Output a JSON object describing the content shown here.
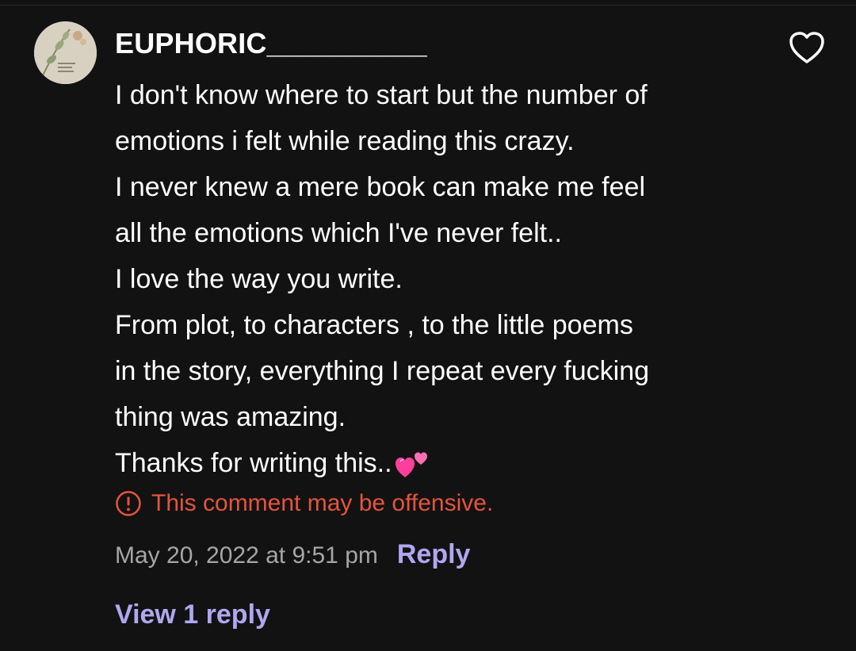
{
  "comment": {
    "username": "EUPHORIC__________",
    "lines": [
      "I don't know where to start but the number of",
      "emotions i felt while reading this crazy.",
      "I never knew a mere book can make me feel",
      "all the emotions which I've never felt..",
      "I love the way you write.",
      "From plot, to characters , to the little poems",
      "in the story,  everything I repeat every fucking",
      "thing was amazing.",
      "Thanks for writing this.."
    ],
    "trailing_emoji": "two-hearts-icon",
    "warning_text": "This comment may be offensive.",
    "timestamp": "May 20, 2022 at 9:51 pm",
    "reply_label": "Reply",
    "view_replies_label": "View 1 reply"
  },
  "colors": {
    "background": "#121212",
    "text": "#ffffff",
    "muted": "#a6a6a6",
    "warning": "#e5543d",
    "accent": "#b0a7f0"
  }
}
